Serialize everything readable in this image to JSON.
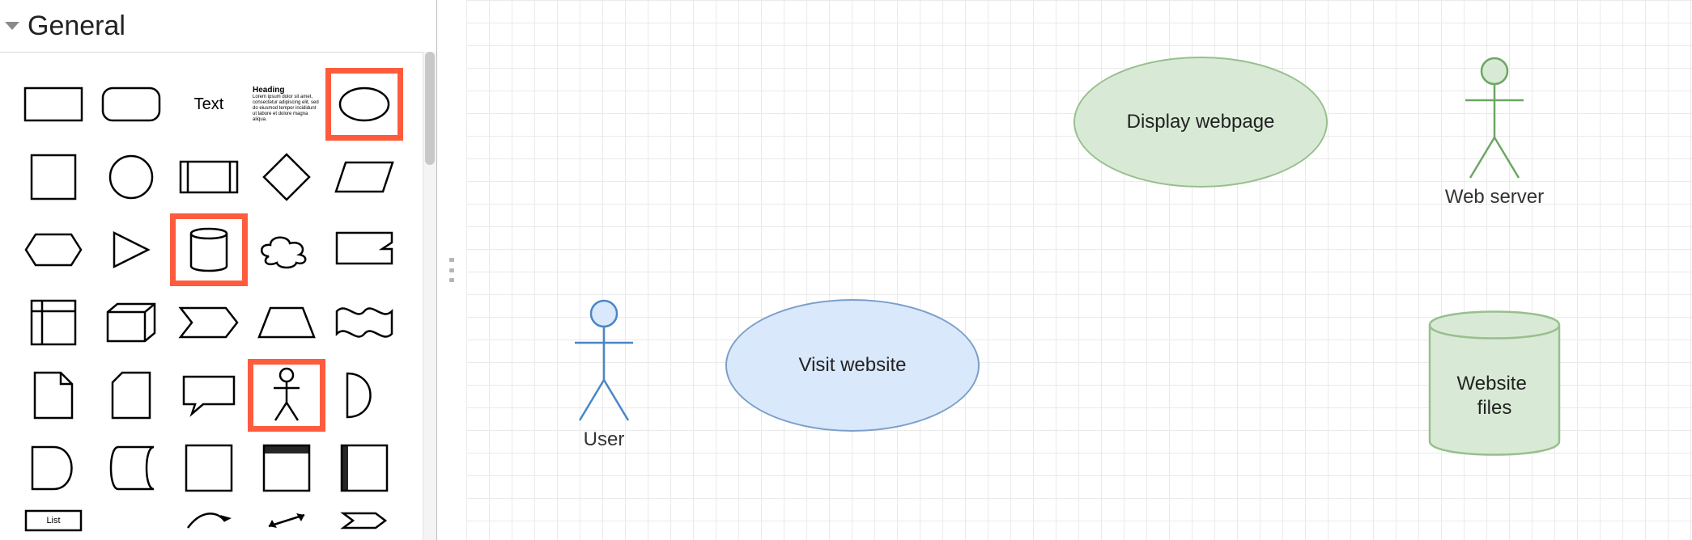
{
  "sidebar": {
    "section_title": "General",
    "shapes": {
      "text_label": "Text",
      "heading_label": "Heading",
      "list_label": "List"
    },
    "highlighted": [
      "ellipse",
      "cylinder",
      "actor"
    ]
  },
  "canvas": {
    "nodes": {
      "user": {
        "label": "User",
        "type": "actor",
        "color": "#4a86c7"
      },
      "visit_website": {
        "label": "Visit website",
        "type": "ellipse",
        "fill": "#dae8fc",
        "stroke": "#7b9fc9"
      },
      "display_webpage": {
        "label": "Display webpage",
        "type": "ellipse",
        "fill": "#d8ead6",
        "stroke": "#98bf8e"
      },
      "web_server": {
        "label": "Web server",
        "type": "actor",
        "color": "#6da664"
      },
      "website_files": {
        "label": "Website files",
        "type": "cylinder",
        "fill": "#d8ead6",
        "stroke": "#98bf8e"
      }
    }
  },
  "colors": {
    "highlight": "#ff5b3d",
    "blue_fill": "#dae8fc",
    "blue_stroke": "#7b9fc9",
    "green_fill": "#d8ead6",
    "green_stroke": "#98bf8e"
  }
}
